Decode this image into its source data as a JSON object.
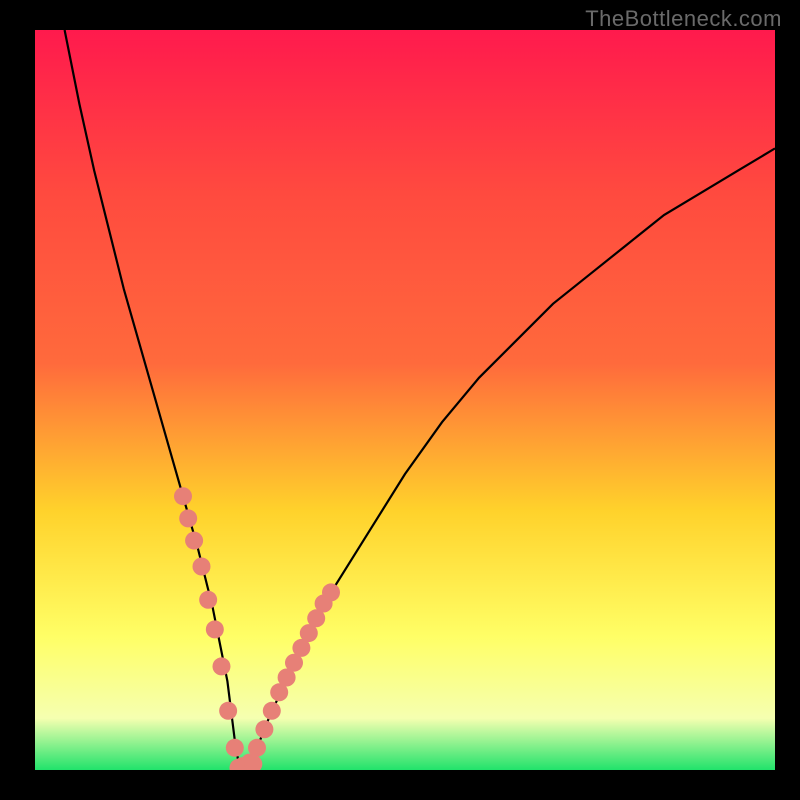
{
  "watermark": "TheBottleneck.com",
  "chart_data": {
    "type": "line",
    "title": "",
    "xlabel": "",
    "ylabel": "",
    "xlim": [
      0,
      100
    ],
    "ylim": [
      0,
      100
    ],
    "grid": false,
    "background_gradient": {
      "top": "#ff1a4d",
      "mid_upper": "#ff6a3c",
      "mid": "#ffd22b",
      "mid_lower": "#ffff66",
      "near_bottom": "#f5ffb0",
      "bottom": "#21e36b"
    },
    "series": [
      {
        "name": "bottleneck-curve",
        "color": "#000000",
        "x": [
          4,
          6,
          8,
          10,
          12,
          14,
          16,
          18,
          20,
          22,
          24,
          26,
          26.5,
          27,
          27.5,
          28,
          28.5,
          29,
          30,
          32,
          35,
          40,
          45,
          50,
          55,
          60,
          65,
          70,
          75,
          80,
          85,
          90,
          95,
          100
        ],
        "y": [
          100,
          90,
          81,
          73,
          65,
          58,
          51,
          44,
          37,
          30,
          22,
          12,
          8,
          4,
          1,
          0,
          0,
          1,
          3,
          8,
          14,
          24,
          32,
          40,
          47,
          53,
          58,
          63,
          67,
          71,
          75,
          78,
          81,
          84
        ]
      }
    ],
    "markers": [
      {
        "name": "left-branch-dots",
        "color": "#e78077",
        "radius_px": 9,
        "x": [
          20.0,
          20.7,
          21.5,
          22.5,
          23.4,
          24.3,
          25.2,
          26.1,
          27.0,
          28.0
        ],
        "y": [
          37.0,
          34.0,
          31.0,
          27.5,
          23.0,
          19.0,
          14.0,
          8.0,
          3.0,
          0.5
        ]
      },
      {
        "name": "right-branch-dots",
        "color": "#e78077",
        "radius_px": 9,
        "x": [
          29.0,
          30.0,
          31.0,
          32.0,
          33.0,
          34.0,
          35.0,
          36.0,
          37.0,
          38.0,
          39.0,
          40.0
        ],
        "y": [
          1.0,
          3.0,
          5.5,
          8.0,
          10.5,
          12.5,
          14.5,
          16.5,
          18.5,
          20.5,
          22.5,
          24.0
        ]
      },
      {
        "name": "bottom-dots",
        "color": "#e78077",
        "radius_px": 9,
        "x": [
          27.5,
          28.5,
          29.5
        ],
        "y": [
          0.3,
          0.3,
          0.8
        ]
      }
    ]
  }
}
